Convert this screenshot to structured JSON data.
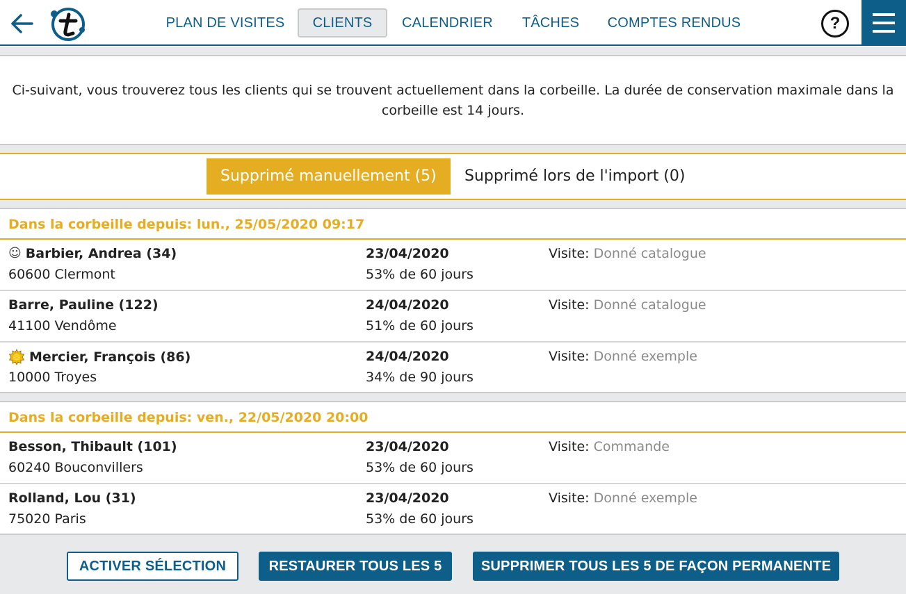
{
  "nav": {
    "items": [
      {
        "label": "PLAN DE VISITES"
      },
      {
        "label": "CLIENTS"
      },
      {
        "label": "CALENDRIER"
      },
      {
        "label": "TÂCHES"
      },
      {
        "label": "COMPTES RENDUS"
      }
    ],
    "active": "CLIENTS",
    "help_label": "?"
  },
  "intro": {
    "text": "Ci-suivant, vous trouverez tous les clients qui se trouvent actuellement dans la corbeille. La durée de conservation maximale dans la corbeille est 14 jours."
  },
  "tabs": [
    {
      "label": "Supprimé manuellement (5)",
      "active": true
    },
    {
      "label": "Supprimé lors de l'import (0)",
      "active": false
    }
  ],
  "groups": [
    {
      "header": "Dans la corbeille depuis: lun., 25/05/2020 09:17",
      "rows": [
        {
          "icon": "smiley-icon",
          "icon_glyph": "☺",
          "name": "Barbier, Andrea (34)",
          "address": "60600 Clermont",
          "date": "23/04/2020",
          "progress": "53% de 60 jours",
          "visit_label": "Visite:",
          "visit_value": "Donné catalogue"
        },
        {
          "icon": "",
          "name": "Barre, Pauline (122)",
          "address": "41100 Vendôme",
          "date": "24/04/2020",
          "progress": "51% de 60 jours",
          "visit_label": "Visite:",
          "visit_value": "Donné catalogue"
        },
        {
          "icon": "sun-icon",
          "name": "Mercier, François (86)",
          "address": "10000 Troyes",
          "date": "24/04/2020",
          "progress": "34% de 90 jours",
          "visit_label": "Visite:",
          "visit_value": "Donné exemple"
        }
      ]
    },
    {
      "header": "Dans la corbeille depuis: ven., 22/05/2020 20:00",
      "rows": [
        {
          "icon": "",
          "name": "Besson, Thibault (101)",
          "address": "60240 Bouconvillers",
          "date": "23/04/2020",
          "progress": "53% de 60 jours",
          "visit_label": "Visite:",
          "visit_value": "Commande"
        },
        {
          "icon": "",
          "name": "Rolland, Lou (31)",
          "address": "75020 Paris",
          "date": "23/04/2020",
          "progress": "53% de 60 jours",
          "visit_label": "Visite:",
          "visit_value": "Donné exemple"
        }
      ]
    }
  ],
  "footer": {
    "activate_label": "ACTIVER SÉLECTION",
    "restore_label": "RESTAURER TOUS LES 5",
    "delete_label": "SUPPRIMER TOUS LES 5 DE FAÇON PERMANENTE"
  },
  "colors": {
    "primary": "#0e5e8a",
    "accent": "#e5ad22",
    "muted_text": "#8a8a8a",
    "footer_bg": "#e8e9ea"
  }
}
